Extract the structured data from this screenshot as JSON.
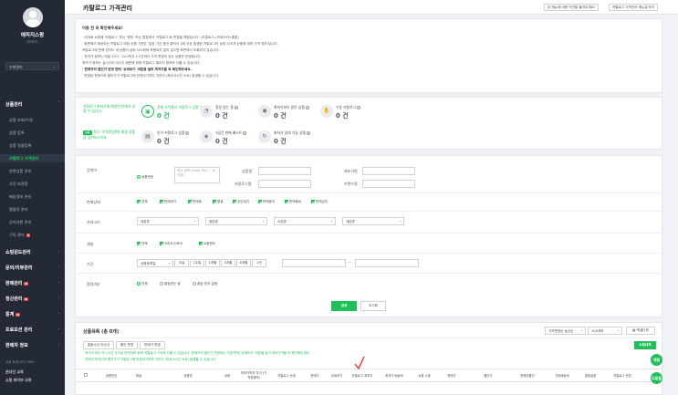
{
  "sidebar": {
    "profile": {
      "name": "에피지스팜",
      "sub": "(판매자)"
    },
    "select_label": "수퍼관리",
    "sections": {
      "product": "상품관리",
      "store": "쇼핑윈도관리",
      "order": "판매관리",
      "delivery": "정산관리",
      "talk": "톡톡상담관리",
      "goods": "문의/리뷰관리",
      "bizad": "통계",
      "stats": "판매자 정보",
      "seller": "프로모션 관리",
      "promo": "판매자 정보"
    },
    "items": [
      "상품 조회/수정",
      "상품 등록",
      "상품 일괄등록",
      "카탈로그 가격관리",
      "연관상품 관리",
      "사진 보관함",
      "배송정보 관리",
      "템플릿 관리",
      "공지사항 관리",
      "구독 관리"
    ],
    "new_badge": "N",
    "footer1": "상품 등록/관리 서비스",
    "footer2": "온라인 교육",
    "footer3": "쇼핑 파이브 교육"
  },
  "header": {
    "title": "카탈로그 가격관리",
    "btn1": "본 메뉴에 대한 의견을 들려주세요!",
    "btn2": "카탈로그 가격관리 메뉴얼 보기"
  },
  "notice": {
    "head": "이용 전 꼭 확인해주세요!",
    "lines": [
      "· 네이버 쇼핑에 '카탈로그' 또는 '원부' 라는 명칭에서 '카탈로그'로 변경될 예정입니다. (카탈로그=카테고리+통합)",
      "· 화면에서 제공되는 카탈로그 매칭 상품 기준은 '일정 기간 동안 클릭이 1회 이상 발생한 카탈로그의 상위 100개 상품에 대한 가격 정보'입니다.",
      "  카탈로그에 판매 업자도 내 상품이 상위 100위에 포함되지 않지 않으면 화면에서 조회되지 않습니다.",
      "· 최저가 정보는 매일 10시~12시까지 1시간마다 가격 변경이 있는 상품만 반영됩니다.",
      "  최저가 정보는 실시간이 아니기 때문에 현재 카탈로그 페이지 정보와 다를 수 있습니다.",
      "· 판매자의 할인가 변경 판매 '상세보기' 버튼을 눌러 최저가를 꼭 확인해주세요.",
      "· 변경된 판매가와 할인가가 카탈로그에 반영되기까지 지연이 (최대 8시간 소요) 발생할 수 있습니다."
    ],
    "bold_index": 5
  },
  "stats": {
    "row1_left": "카탈로그 최저가에 매칭된 판매자 상품 수 입니다.",
    "row2_tag": "상품",
    "row2_left": "최근 가격알림변화 통합 상품을 참여보시지요",
    "items": [
      {
        "label": "전체 가격관리 카탈로그 상품 수",
        "value": "0 건",
        "green": true
      },
      {
        "label": "알림 받는 중",
        "value": "0 건",
        "green": false
      },
      {
        "label": "최저가보다 같은 상품",
        "value": "0 건",
        "green": false
      },
      {
        "label": "수동 카탈로그",
        "value": "0 건",
        "green": false
      },
      {
        "label": "인기 카탈로그 상품",
        "value": "0 건",
        "green": false
      },
      {
        "label": "3일간 판매 베스트",
        "value": "0 건",
        "green": false
      },
      {
        "label": "최저가 업데 가능 상품",
        "value": "0 건",
        "green": false
      }
    ]
  },
  "search": {
    "labels": {
      "query": "검색어",
      "status": "판매상태",
      "category": "카테고리",
      "channel": "채널",
      "period": "기간",
      "alert": "알림여부"
    },
    "query_radio": "상품번호",
    "query_placeholder": "복수 검색 (enter 또는 ',' 로 구분)",
    "fields": {
      "name": "상품명",
      "model": "제조사명",
      "catalog": "카탈로그명",
      "brand": "브랜드명"
    },
    "status_opts": [
      "전체",
      "판매대기",
      "판매중",
      "품절",
      "승인대기",
      "판매중지",
      "판매종료",
      "판매금지"
    ],
    "category_opts": [
      "대분류",
      "중분류",
      "소분류",
      "세분류"
    ],
    "channel_opts": [
      "전체",
      "스마트스토어",
      "쇼핑윈도"
    ],
    "period_dd": "상품등록일",
    "period_btns": [
      "오늘",
      "1주일",
      "1개월",
      "3개월",
      "6개월",
      "1년"
    ],
    "alert_opts": [
      "전체",
      "알림받는 중",
      "알림 받지 않음"
    ],
    "btn_search": "검색",
    "btn_reset": "초기화"
  },
  "list": {
    "title": "상품목록 (총 0개)",
    "sort": "가격변경순 높은순",
    "per_page": "100개씩",
    "excel": "엑셀다운",
    "btns": [
      "알람수신 미수신",
      "할인 변경",
      "판매가 변경"
    ],
    "right_btn": "수정내역",
    "help1": "· 최저가 보다 약 1시간 주기로 반영되며 현재 카탈로그 가격과 다를 수 있습니다. 판매자의 할인가 변경하는 가장 판매 '상세보기' 버튼을 눌러 최저가격을 꼭 확인해주세요.",
    "help2": "· 판매가 판매가와 할인가가 카탈로그에 반영되기까지 지연이 (최대 8시간 소요) 발생할 수 있습니다.",
    "cols": [
      "상품번호",
      "채널",
      "상품명",
      "상태",
      "최저가까지 차이 (가격경쟁력)",
      "카탈로그 순위",
      "판매가",
      "상세보기",
      "카탈로그 최저가",
      "최저가 배송비",
      "쇼핑 수량",
      "판매가",
      "할인가",
      "판매자할인",
      "기본배송비",
      "알림설정",
      "카탈로그 번호"
    ]
  },
  "fab": {
    "top": "채팅",
    "bottom": "도움말"
  }
}
